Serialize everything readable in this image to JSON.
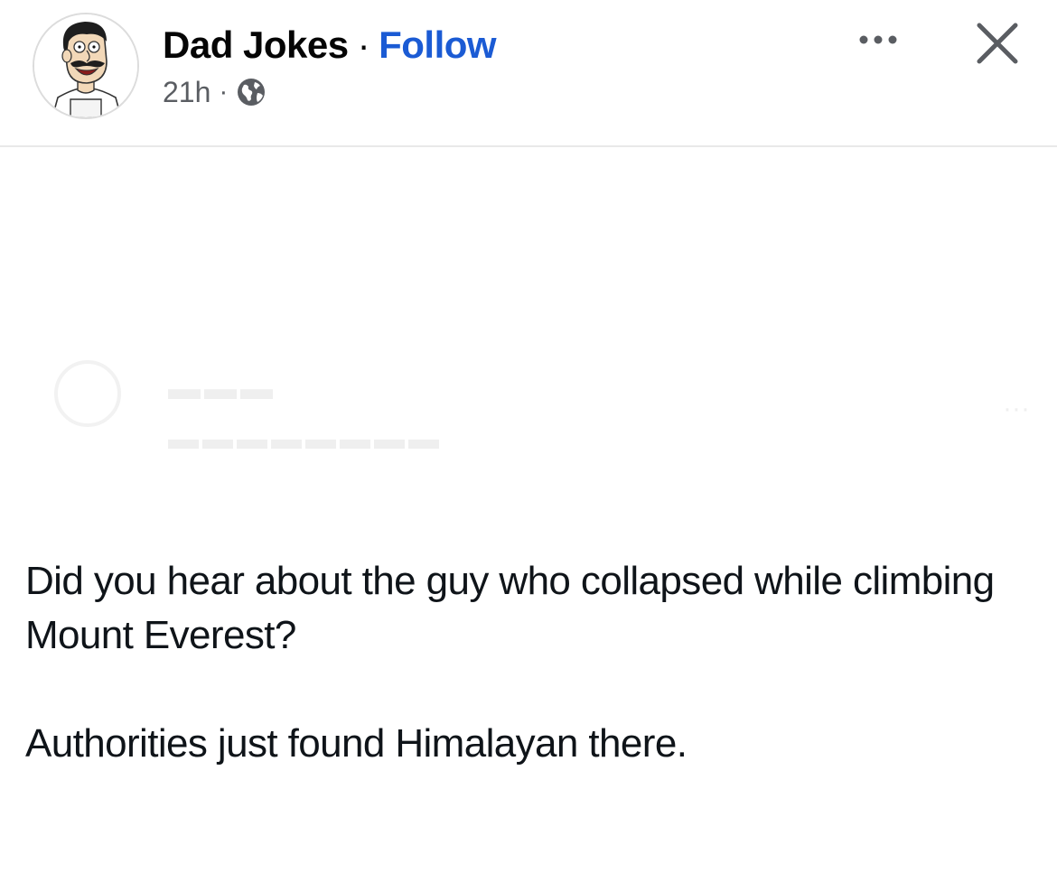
{
  "post": {
    "page_name": "Dad Jokes",
    "separator": "·",
    "follow_label": "Follow",
    "time": "21h",
    "meta_separator": "·",
    "audience_icon": "globe-icon",
    "more_icon": "more-horizontal-icon",
    "close_icon": "close-icon"
  },
  "content": {
    "line_question": "Did you hear about the guy who collapsed while climbing Mount Everest?",
    "line_answer": "Authorities just found Himalayan there."
  },
  "colors": {
    "follow": "#1b5bd4",
    "text": "#050505",
    "meta": "#5a5d62",
    "divider": "#e9e9e9"
  }
}
